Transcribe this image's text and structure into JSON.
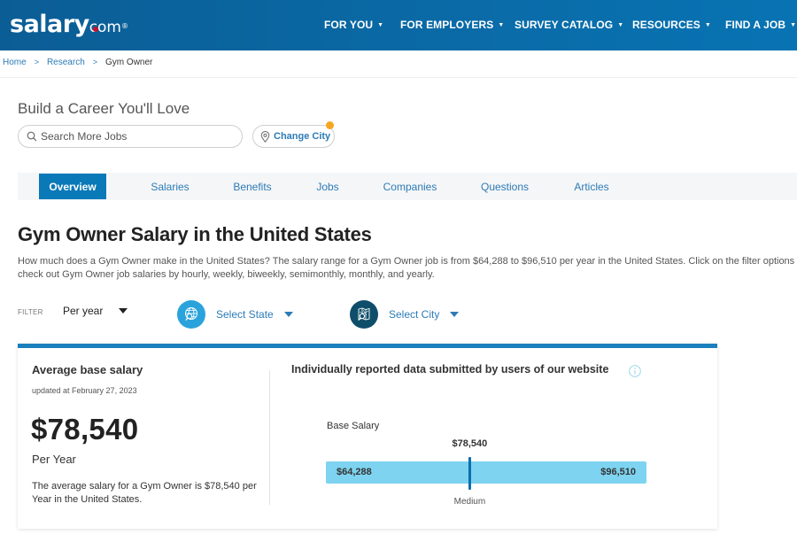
{
  "header": {
    "logo_main": "salary",
    "logo_suffix": "com",
    "logo_reg": "®",
    "brand_color": "#0a6aa6",
    "nav": [
      {
        "label": "FOR YOU",
        "icon": "caret-down-icon"
      },
      {
        "label": "FOR EMPLOYERS",
        "icon": "caret-down-icon"
      },
      {
        "label": "SURVEY CATALOG",
        "icon": "caret-down-icon"
      },
      {
        "label": "RESOURCES",
        "icon": "caret-down-icon"
      },
      {
        "label": "FIND A JOB",
        "icon": "caret-down-icon"
      }
    ],
    "caret": "▼"
  },
  "breadcrumb": {
    "items": [
      "Home",
      "Research",
      "Gym Owner"
    ],
    "separator": ">"
  },
  "hero": {
    "title": "Build a Career You'll Love",
    "search_placeholder": "Search More Jobs",
    "search_icon": "search-icon",
    "change_city_label": "Change City",
    "change_city_icon": "map-pin-icon",
    "notification_color": "#f5a623"
  },
  "tabs": [
    {
      "label": "Overview",
      "active": true
    },
    {
      "label": "Salaries",
      "active": false
    },
    {
      "label": "Benefits",
      "active": false
    },
    {
      "label": "Jobs",
      "active": false
    },
    {
      "label": "Companies",
      "active": false
    },
    {
      "label": "Questions",
      "active": false
    },
    {
      "label": "Articles",
      "active": false
    }
  ],
  "main": {
    "title": "Gym Owner Salary in the United States",
    "description_line1": "How much does a Gym Owner make in the United States? The salary range for a Gym Owner job is from $64,288 to $96,510 per year in the United States. Click on the filter options to",
    "description_line2": "check out Gym Owner job salaries by hourly, weekly, biweekly, semimonthly, monthly, and yearly."
  },
  "filter": {
    "label": "FILTER",
    "period_selected": "Per year",
    "state_label": "Select State",
    "state_icon": "globe-search-icon",
    "state_icon_color": "#2aa3dc",
    "city_label": "Select City",
    "city_icon": "map-search-icon",
    "city_icon_color": "#0f4e6b"
  },
  "salary_card": {
    "avg_title": "Average base salary",
    "updated": "updated at February 27, 2023",
    "amount": "$78,540",
    "period": "Per Year",
    "description": "The average salary for a Gym Owner is $78,540 per Year in the United States.",
    "reported_title": "Individually reported data submitted by users of our website",
    "info_icon": "info-icon",
    "range": {
      "label": "Base Salary",
      "low": 64288,
      "low_label": "$64,288",
      "high": 96510,
      "high_label": "$96,510",
      "median": 78540,
      "median_label": "$78,540",
      "marker_label": "Medium"
    },
    "accent_color": "#1a80bd",
    "bar_color": "#7dd3f0"
  }
}
